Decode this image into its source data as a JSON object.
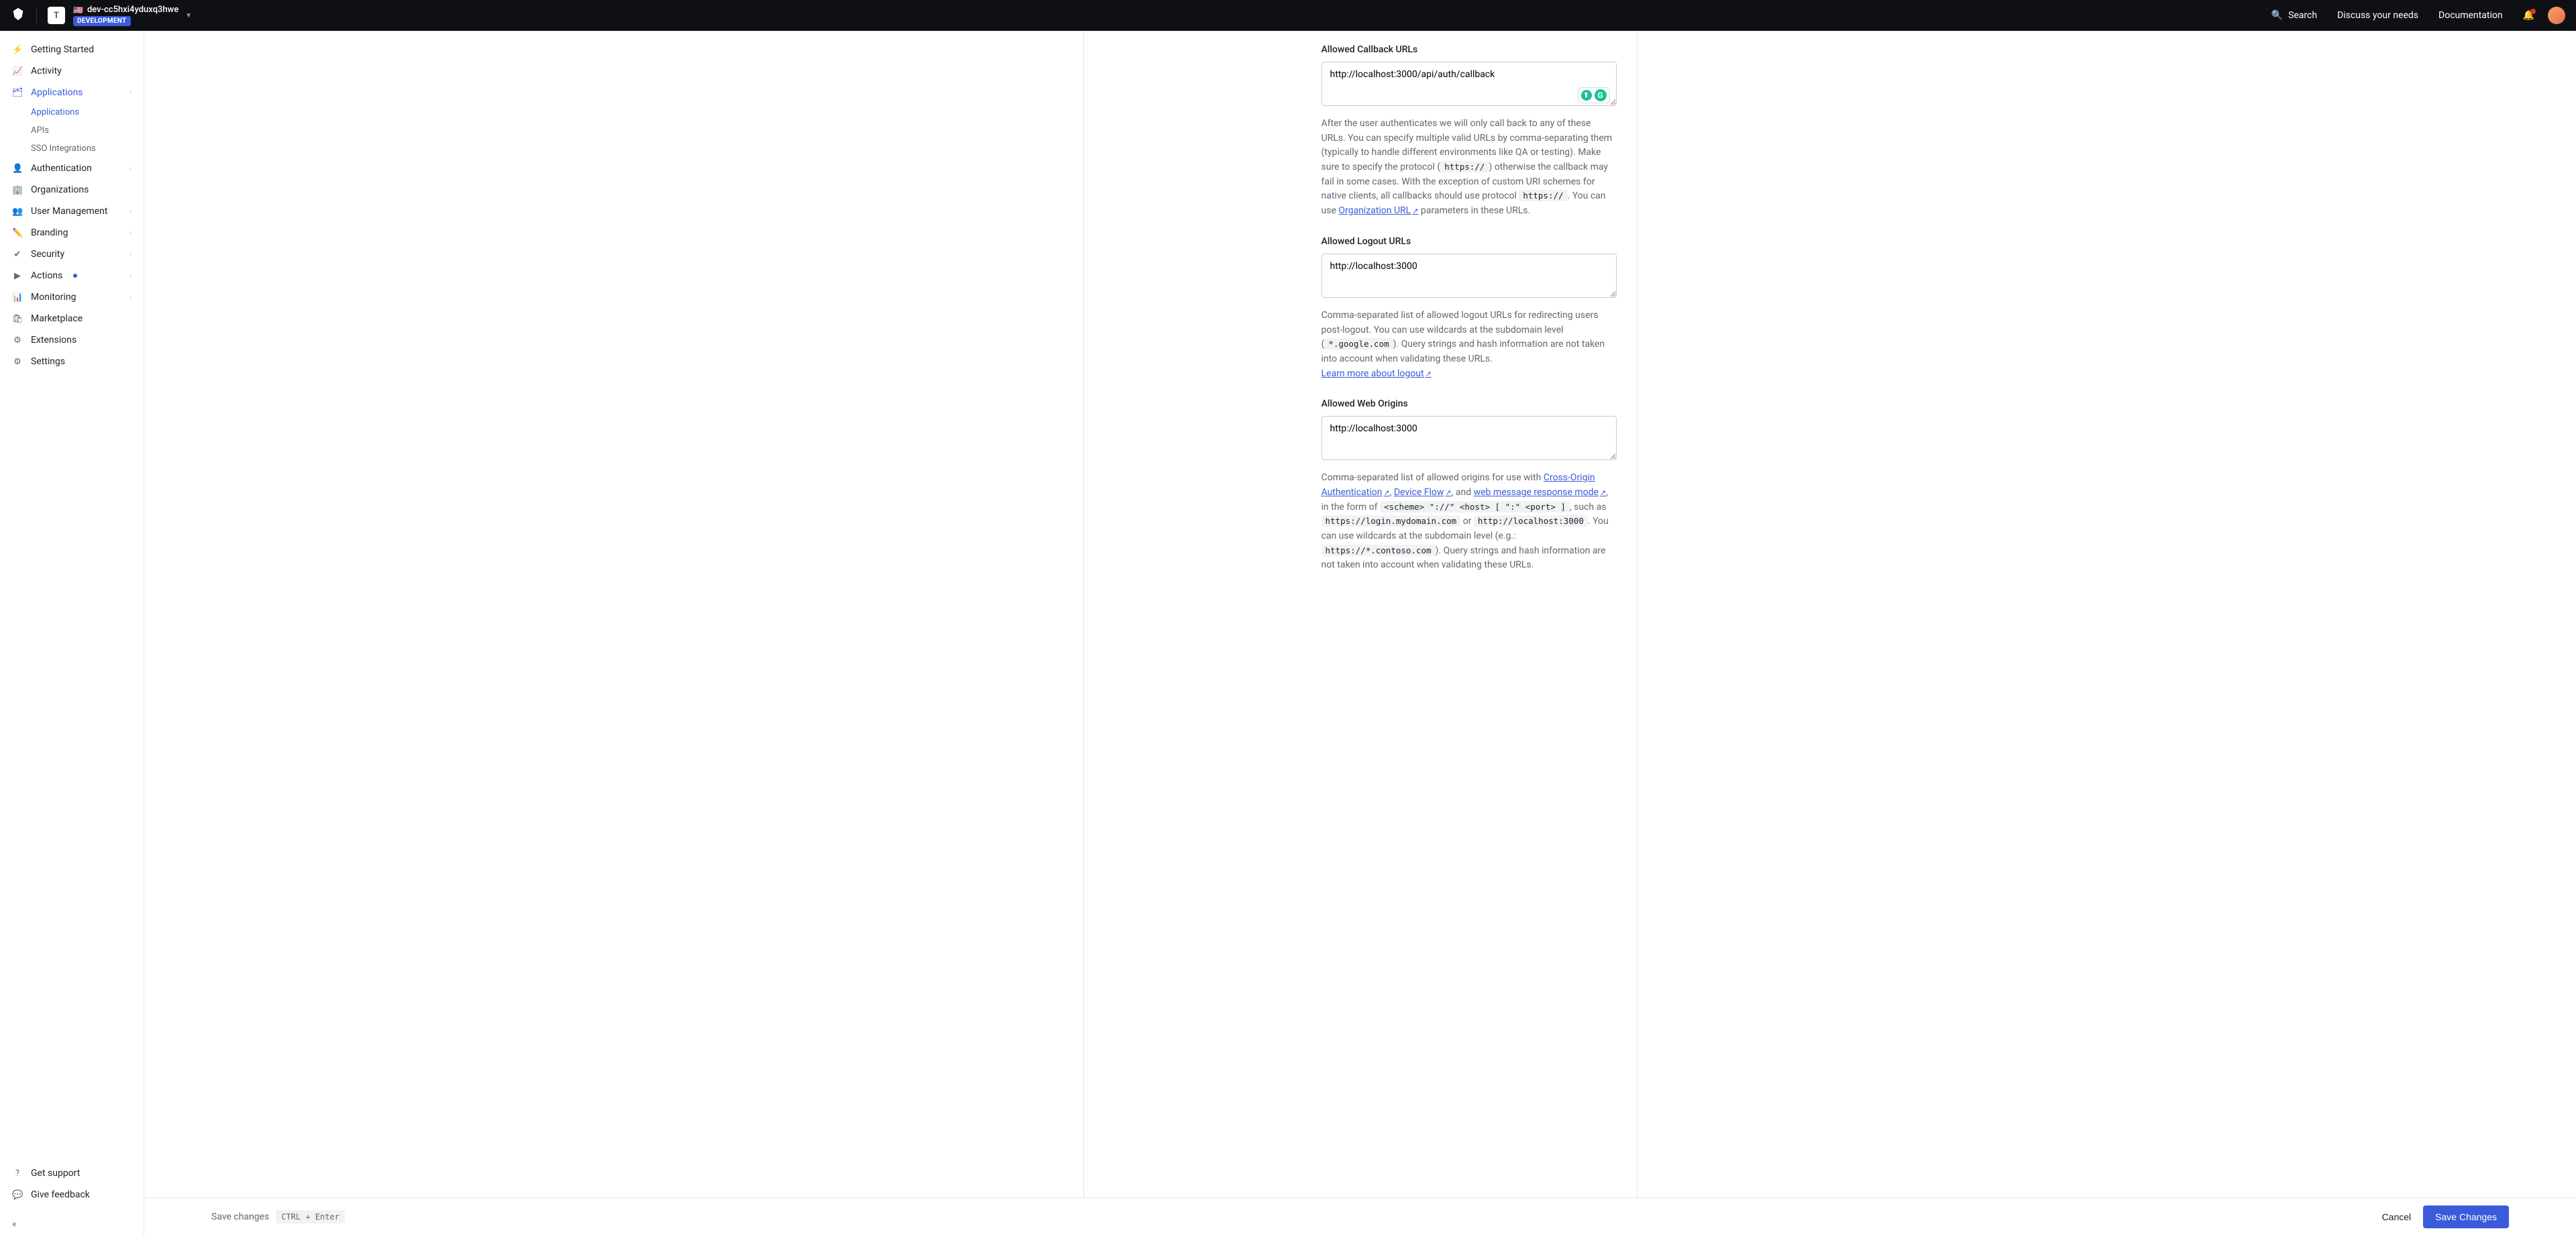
{
  "header": {
    "tenant_initial": "T",
    "tenant_name": "dev-cc5hxi4yduxq3hwe",
    "env_badge": "DEVELOPMENT",
    "search": "Search",
    "discuss": "Discuss your needs",
    "docs": "Documentation"
  },
  "sidebar": {
    "items": [
      {
        "label": "Getting Started",
        "icon": "⚡"
      },
      {
        "label": "Activity",
        "icon": "📈"
      },
      {
        "label": "Applications",
        "icon": "🗂",
        "active": true,
        "expandable": true,
        "children": [
          {
            "label": "Applications",
            "active": true
          },
          {
            "label": "APIs"
          },
          {
            "label": "SSO Integrations"
          }
        ]
      },
      {
        "label": "Authentication",
        "icon": "👤",
        "expandable": true
      },
      {
        "label": "Organizations",
        "icon": "🏢"
      },
      {
        "label": "User Management",
        "icon": "👥",
        "expandable": true
      },
      {
        "label": "Branding",
        "icon": "✏️",
        "expandable": true
      },
      {
        "label": "Security",
        "icon": "✔",
        "expandable": true
      },
      {
        "label": "Actions",
        "icon": "▶",
        "expandable": true,
        "dot": true
      },
      {
        "label": "Monitoring",
        "icon": "📊",
        "expandable": true
      },
      {
        "label": "Marketplace",
        "icon": "🛍"
      },
      {
        "label": "Extensions",
        "icon": "⚙"
      },
      {
        "label": "Settings",
        "icon": "⚙"
      }
    ],
    "bottom": [
      {
        "label": "Get support",
        "icon": "?"
      },
      {
        "label": "Give feedback",
        "icon": "💬"
      }
    ]
  },
  "form": {
    "callback": {
      "label": "Allowed Callback URLs",
      "value": "http://localhost:3000/api/auth/callback",
      "help_pre": "After the user authenticates we will only call back to any of these URLs. You can specify multiple valid URLs by comma-separating them (typically to handle different environments like QA or testing). Make sure to specify the protocol (",
      "code1": "https://",
      "help_mid": ") otherwise the callback may fail in some cases. With the exception of custom URI schemes for native clients, all callbacks should use protocol ",
      "code2": "https://",
      "help_mid2": ". You can use ",
      "link": "Organization URL",
      "help_post": " parameters in these URLs."
    },
    "logout": {
      "label": "Allowed Logout URLs",
      "value": "http://localhost:3000",
      "help_pre": "Comma-separated list of allowed logout URLs for redirecting users post-logout. You can use wildcards at the subdomain level (",
      "code1": "*.google.com",
      "help_mid": "). Query strings and hash information are not taken into account when validating these URLs. ",
      "link": "Learn more about logout"
    },
    "web_origins": {
      "label": "Allowed Web Origins",
      "value": "http://localhost:3000",
      "help_pre": "Comma-separated list of allowed origins for use with ",
      "link1": "Cross-Origin Authentication",
      "sep1": ", ",
      "link2": "Device Flow",
      "sep2": ", and ",
      "link3": "web message response mode",
      "help_mid": ", in the form of ",
      "code1": "<scheme> \"://\" <host> [ \":\" <port> ]",
      "help_mid2": ", such as ",
      "code2": "https://login.mydomain.com",
      "or": " or ",
      "code3": "http://localhost:3000",
      "help_mid3": ". You can use wildcards at the subdomain level (e.g.: ",
      "code4": "https://*.contoso.com",
      "help_post": "). Query strings and hash information are not taken into account when validating these URLs."
    }
  },
  "footer": {
    "save_hint": "Save changes",
    "kbd": "CTRL + Enter",
    "cancel": "Cancel",
    "save": "Save Changes"
  }
}
